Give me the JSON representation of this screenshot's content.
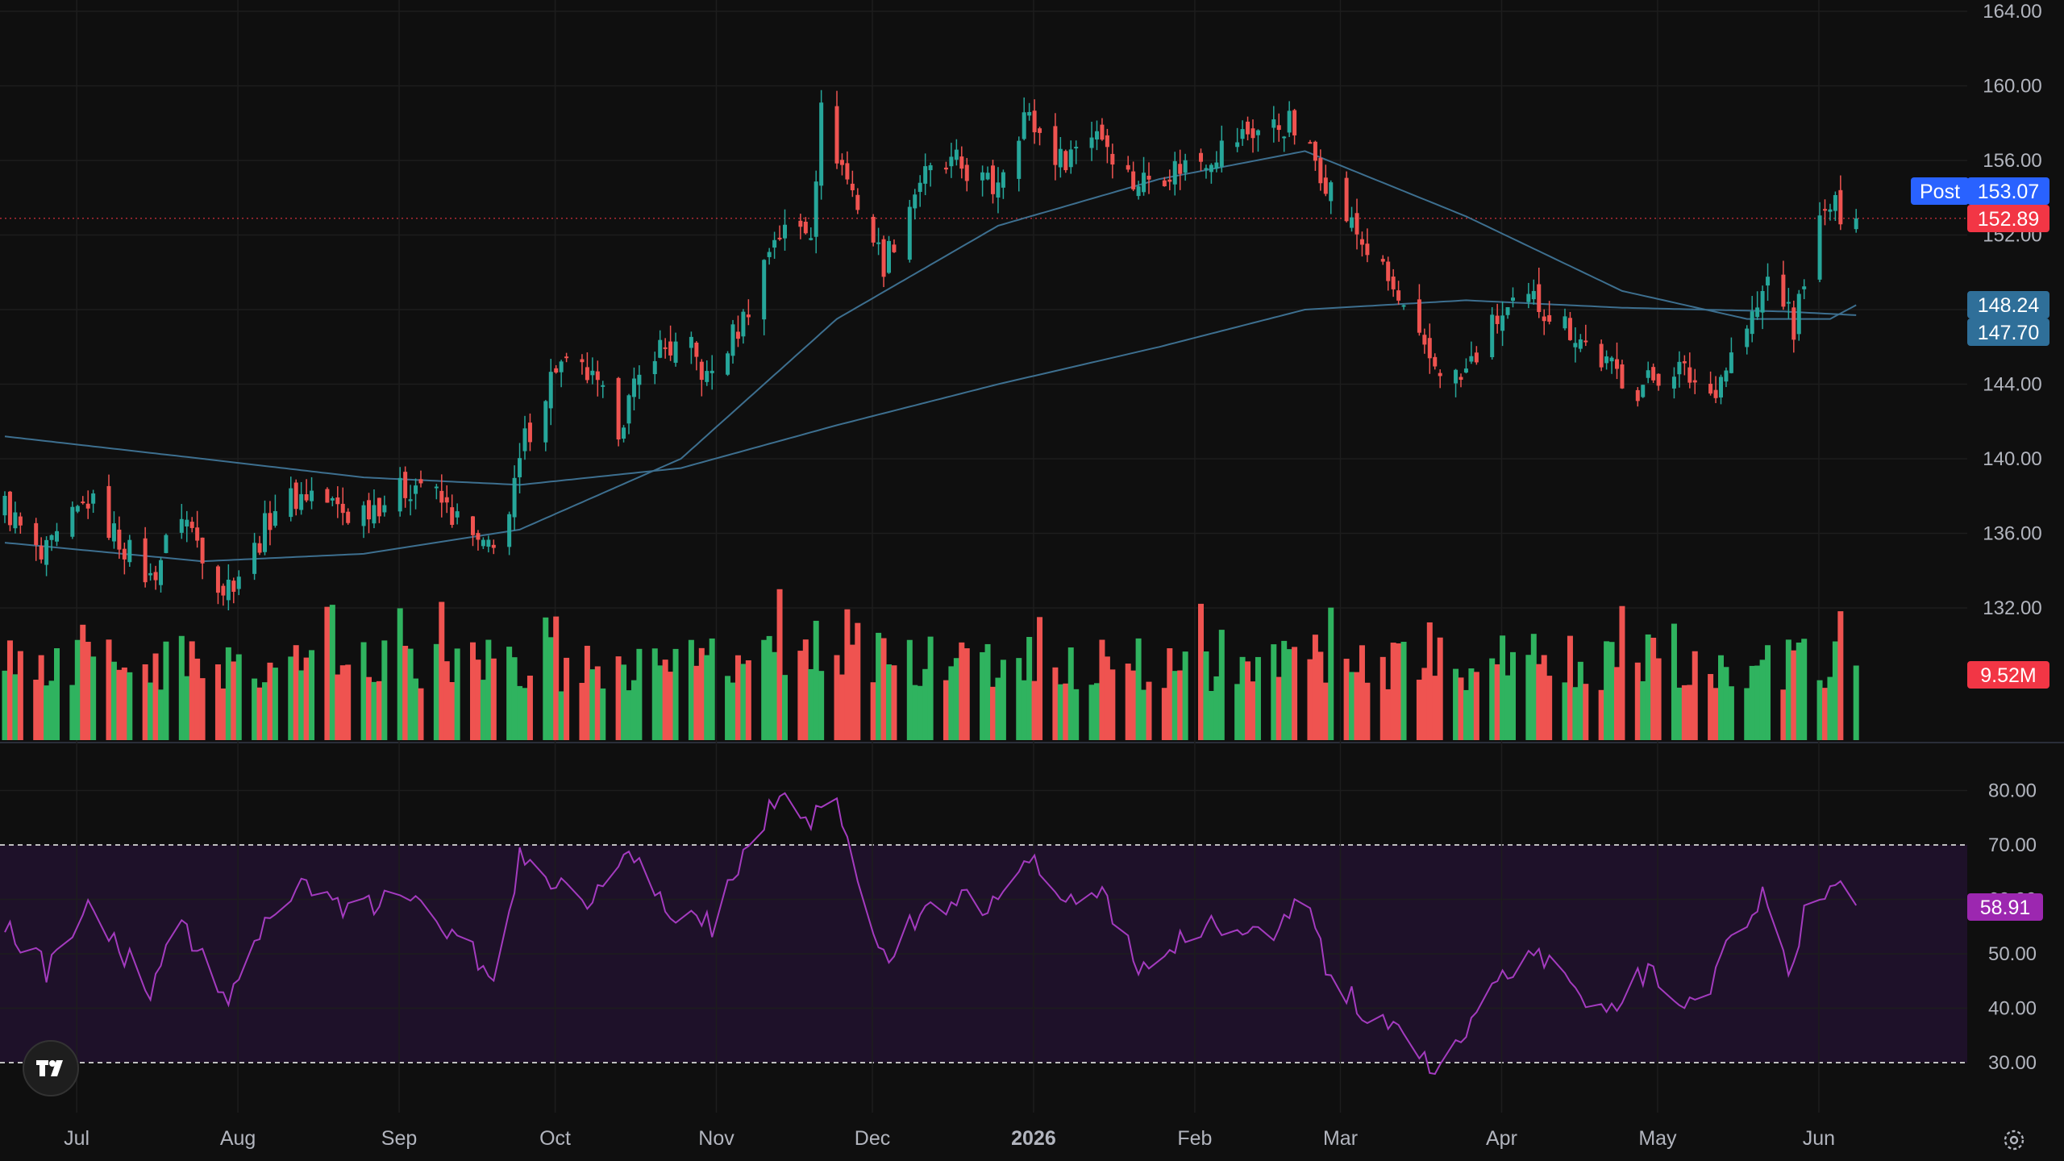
{
  "colors": {
    "background": "#0f0f0f",
    "grid": "#1d1d1d",
    "up": "#26a69a",
    "up_volume": "#2fb35f",
    "down": "#ef5350",
    "ma_line": "#3d6f8f",
    "rsi_line": "#a43bbf",
    "rsi_band": "#1e1129",
    "axis_text": "#b2b5be",
    "post_badge": "#2962ff",
    "price_badge": "#f23645",
    "ma_badge": "#2f6f99",
    "rsi_badge": "#9c27b0"
  },
  "price_axis": {
    "labels": [
      "164.00",
      "160.00",
      "156.00",
      "152.00",
      "148.00",
      "144.00",
      "140.00",
      "136.00",
      "132.00"
    ]
  },
  "rsi_axis": {
    "labels": [
      "80.00",
      "70.00",
      "60.00",
      "50.00",
      "40.00",
      "30.00"
    ]
  },
  "time_axis": {
    "labels": [
      "Jul",
      "Aug",
      "Sep",
      "Oct",
      "Nov",
      "Dec",
      "2026",
      "Feb",
      "Mar",
      "Apr",
      "May",
      "Jun"
    ],
    "bold": [
      "2026"
    ]
  },
  "badges": {
    "post_label": "Post",
    "post_price": "153.07",
    "last_price": "152.89",
    "ma_fast": "148.24",
    "ma_slow": "147.70",
    "volume": "9.52M",
    "rsi": "58.91"
  },
  "icons": {
    "logo": "tradingview-logo-icon",
    "settings": "settings-gear-icon"
  },
  "chart_data": {
    "type": "candlestick",
    "panes": [
      "price",
      "volume",
      "rsi"
    ],
    "price_ylim": [
      130,
      165
    ],
    "rsi_ylim": [
      25,
      85
    ],
    "rsi_band": [
      30,
      70
    ],
    "last_price": 152.89,
    "post_price": 153.07,
    "ma_fast_value": 148.24,
    "ma_slow_value": 147.7,
    "last_volume": "9.52M",
    "last_rsi": 58.91,
    "grid": true,
    "anchors": [
      [
        "2025-06-24",
        137.5
      ],
      [
        "2025-07-01",
        134.5
      ],
      [
        "2025-07-10",
        137.8
      ],
      [
        "2025-07-22",
        133.5
      ],
      [
        "2025-07-28",
        137.2
      ],
      [
        "2025-08-05",
        133.0
      ],
      [
        "2025-08-10",
        134.5
      ],
      [
        "2025-08-15",
        137.5
      ],
      [
        "2025-08-22",
        138.2
      ],
      [
        "2025-08-29",
        137.0
      ],
      [
        "2025-09-05",
        137.8
      ],
      [
        "2025-09-12",
        138.8
      ],
      [
        "2025-09-18",
        137.0
      ],
      [
        "2025-09-24",
        135.0
      ],
      [
        "2025-09-29",
        137.0
      ],
      [
        "2025-10-02",
        141.0
      ],
      [
        "2025-10-08",
        145.0
      ],
      [
        "2025-10-14",
        144.5
      ],
      [
        "2025-10-20",
        141.8
      ],
      [
        "2025-10-27",
        146.0
      ],
      [
        "2025-11-03",
        145.8
      ],
      [
        "2025-11-06",
        144.2
      ],
      [
        "2025-11-13",
        147.5
      ],
      [
        "2025-11-19",
        152.0
      ],
      [
        "2025-11-26",
        152.5
      ],
      [
        "2025-11-28",
        158.5
      ],
      [
        "2025-12-03",
        155.0
      ],
      [
        "2025-12-10",
        150.5
      ],
      [
        "2025-12-17",
        155.0
      ],
      [
        "2025-12-24",
        155.8
      ],
      [
        "2025-12-31",
        154.5
      ],
      [
        "2026-01-06",
        158.5
      ],
      [
        "2026-01-13",
        156.0
      ],
      [
        "2026-01-20",
        157.8
      ],
      [
        "2026-01-27",
        154.8
      ],
      [
        "2026-02-03",
        155.5
      ],
      [
        "2026-02-10",
        156.2
      ],
      [
        "2026-02-18",
        157.5
      ],
      [
        "2026-02-26",
        158.0
      ],
      [
        "2026-03-03",
        156.0
      ],
      [
        "2026-03-10",
        152.5
      ],
      [
        "2026-03-17",
        149.5
      ],
      [
        "2026-03-24",
        145.5
      ],
      [
        "2026-03-31",
        144.2
      ],
      [
        "2026-04-07",
        147.5
      ],
      [
        "2026-04-14",
        148.5
      ],
      [
        "2026-04-21",
        147.0
      ],
      [
        "2026-04-28",
        145.0
      ],
      [
        "2026-05-04",
        143.8
      ],
      [
        "2026-05-11",
        145.0
      ],
      [
        "2026-05-18",
        143.5
      ],
      [
        "2026-05-22",
        145.5
      ],
      [
        "2026-05-27",
        148.0
      ],
      [
        "2026-05-30",
        150.5
      ],
      [
        "2026-06-03",
        146.8
      ],
      [
        "2026-06-06",
        151.5
      ],
      [
        "2026-06-10",
        153.5
      ],
      [
        "2026-06-15",
        152.89
      ]
    ],
    "ma_fast_anchors": [
      [
        "2025-06-24",
        135.5
      ],
      [
        "2025-08-01",
        134.5
      ],
      [
        "2025-09-01",
        134.9
      ],
      [
        "2025-10-01",
        136.2
      ],
      [
        "2025-11-01",
        140.0
      ],
      [
        "2025-12-01",
        147.5
      ],
      [
        "2026-01-01",
        152.5
      ],
      [
        "2026-02-01",
        155.0
      ],
      [
        "2026-03-01",
        156.5
      ],
      [
        "2026-04-01",
        153.0
      ],
      [
        "2026-05-01",
        149.0
      ],
      [
        "2026-05-25",
        147.5
      ],
      [
        "2026-06-10",
        147.5
      ],
      [
        "2026-06-15",
        148.24
      ]
    ],
    "ma_slow_anchors": [
      [
        "2025-06-24",
        141.2
      ],
      [
        "2025-08-01",
        140.0
      ],
      [
        "2025-09-01",
        139.0
      ],
      [
        "2025-10-01",
        138.6
      ],
      [
        "2025-11-01",
        139.5
      ],
      [
        "2025-12-01",
        141.8
      ],
      [
        "2026-01-01",
        144.0
      ],
      [
        "2026-02-01",
        146.0
      ],
      [
        "2026-03-01",
        148.0
      ],
      [
        "2026-04-01",
        148.5
      ],
      [
        "2026-05-01",
        148.1
      ],
      [
        "2026-06-01",
        147.9
      ],
      [
        "2026-06-15",
        147.7
      ]
    ],
    "rsi_anchors": [
      [
        "2025-06-24",
        55
      ],
      [
        "2025-07-02",
        47
      ],
      [
        "2025-07-10",
        60
      ],
      [
        "2025-07-22",
        43
      ],
      [
        "2025-07-28",
        56
      ],
      [
        "2025-08-06",
        42
      ],
      [
        "2025-08-14",
        58
      ],
      [
        "2025-08-22",
        63
      ],
      [
        "2025-08-29",
        57
      ],
      [
        "2025-09-08",
        61
      ],
      [
        "2025-09-14",
        56
      ],
      [
        "2025-09-22",
        50
      ],
      [
        "2025-09-26",
        43
      ],
      [
        "2025-10-01",
        68
      ],
      [
        "2025-10-08",
        63
      ],
      [
        "2025-10-15",
        60
      ],
      [
        "2025-10-22",
        70
      ],
      [
        "2025-10-29",
        58
      ],
      [
        "2025-11-07",
        55
      ],
      [
        "2025-11-14",
        70
      ],
      [
        "2025-11-21",
        80
      ],
      [
        "2025-11-26",
        74
      ],
      [
        "2025-11-30",
        80
      ],
      [
        "2025-12-05",
        62
      ],
      [
        "2025-12-11",
        48
      ],
      [
        "2025-12-17",
        58
      ],
      [
        "2025-12-24",
        60
      ],
      [
        "2026-01-02",
        59
      ],
      [
        "2026-01-07",
        67
      ],
      [
        "2026-01-14",
        58
      ],
      [
        "2026-01-21",
        62
      ],
      [
        "2026-01-28",
        48
      ],
      [
        "2026-02-05",
        52
      ],
      [
        "2026-02-14",
        56
      ],
      [
        "2026-02-24",
        54
      ],
      [
        "2026-03-01",
        60
      ],
      [
        "2026-03-06",
        45
      ],
      [
        "2026-03-13",
        39
      ],
      [
        "2026-03-20",
        34
      ],
      [
        "2026-03-26",
        29
      ],
      [
        "2026-04-01",
        35
      ],
      [
        "2026-04-06",
        44
      ],
      [
        "2026-04-13",
        51
      ],
      [
        "2026-04-20",
        46
      ],
      [
        "2026-04-28",
        38
      ],
      [
        "2026-05-04",
        47
      ],
      [
        "2026-05-10",
        44
      ],
      [
        "2026-05-16",
        40
      ],
      [
        "2026-05-22",
        53
      ],
      [
        "2026-05-28",
        61
      ],
      [
        "2026-06-02",
        48
      ],
      [
        "2026-06-07",
        62
      ],
      [
        "2026-06-12",
        62
      ],
      [
        "2026-06-15",
        58.91
      ]
    ]
  }
}
